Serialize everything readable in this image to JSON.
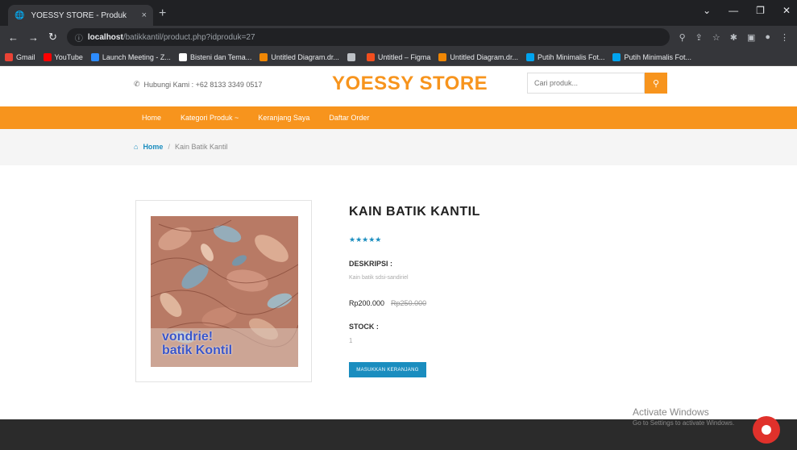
{
  "browser": {
    "tab_title": "YOESSY STORE - Produk",
    "tab_close": "×",
    "new_tab": "+",
    "url_host": "localhost",
    "url_path": "/batikkantil/product.php?idproduk=27",
    "bookmarks": [
      {
        "label": "Gmail",
        "color": "#ea4335"
      },
      {
        "label": "YouTube",
        "color": "#ff0000"
      },
      {
        "label": "Launch Meeting - Z...",
        "color": "#2d8cff"
      },
      {
        "label": "Bisteni dan Tema...",
        "color": "#ffffff"
      },
      {
        "label": "Untitled Diagram.dr...",
        "color": "#f08705"
      },
      {
        "label": "",
        "color": "#bdc1c6"
      },
      {
        "label": "Untitled – Figma",
        "color": "#f24e1e"
      },
      {
        "label": "Untitled Diagram.dr...",
        "color": "#f08705"
      },
      {
        "label": "Putih Minimalis Fot...",
        "color": "#00a4ef"
      },
      {
        "label": "Putih Minimalis Fot...",
        "color": "#00a4ef"
      }
    ]
  },
  "header": {
    "contact": "Hubungi Kami : +62 8133 3349 0517",
    "logo": "YOESSY STORE",
    "search_placeholder": "Cari produk..."
  },
  "nav": {
    "items": [
      "Home",
      "Kategori Produk ~",
      "Keranjang Saya",
      "Daftar Order"
    ]
  },
  "breadcrumb": {
    "home": "Home",
    "separator": "/",
    "current": "Kain Batik Kantil"
  },
  "product": {
    "title": "KAIN BATIK KANTIL",
    "rating_stars": "★★★★★",
    "desc_label": "DESKRIPSI :",
    "description": "Kain batik sdsi-sandiriel",
    "price": "Rp200.000",
    "old_price": "Rp250.000",
    "stock_label": "STOCK :",
    "stock_value": "1",
    "cart_button": "MASUKKAN KERANJANG",
    "image_text_line1": "vondrie!",
    "image_text_line2": "batik Kontil"
  },
  "overlay": {
    "activate_title": "Activate Windows",
    "activate_sub": "Go to Settings to activate Windows."
  },
  "colors": {
    "brand": "#f7941d",
    "link": "#1a8dbf"
  }
}
